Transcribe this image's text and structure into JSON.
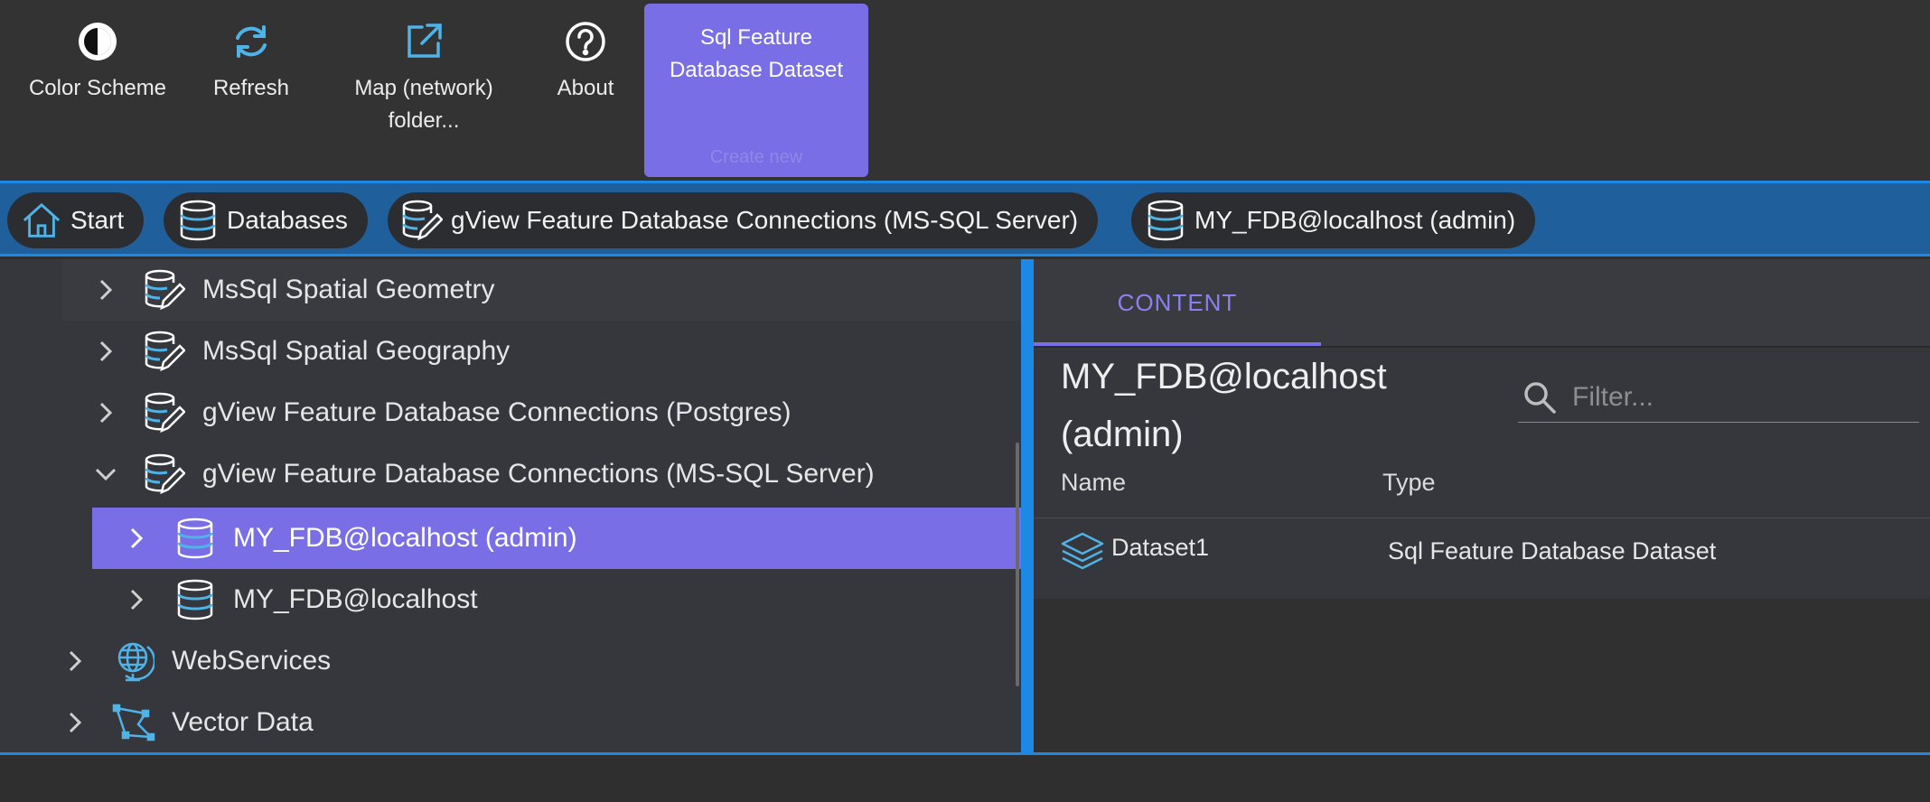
{
  "toolbar": {
    "color_scheme": "Color Scheme",
    "refresh": "Refresh",
    "map_folder": "Map (network) folder...",
    "about": "About",
    "create_title": "Sql Feature Database Dataset",
    "create_sub": "Create new"
  },
  "breadcrumbs": {
    "start": "Start",
    "databases": "Databases",
    "connections": "gView Feature Database Connections (MS-SQL Server)",
    "current": "MY_FDB@localhost (admin)"
  },
  "tree": {
    "items": [
      {
        "label": "MsSql Spatial Geometry"
      },
      {
        "label": "MsSql Spatial Geography"
      },
      {
        "label": "gView Feature Database Connections (Postgres)"
      },
      {
        "label": "gView Feature Database Connections (MS-SQL Server)"
      },
      {
        "label": "MY_FDB@localhost (admin)"
      },
      {
        "label": "MY_FDB@localhost"
      },
      {
        "label": "WebServices"
      },
      {
        "label": "Vector Data"
      }
    ]
  },
  "content": {
    "tab": "CONTENT",
    "title": "MY_FDB@localhost (admin)",
    "filter_placeholder": "Filter...",
    "columns": {
      "name": "Name",
      "type": "Type"
    },
    "rows": [
      {
        "name": "Dataset1",
        "type": "Sql Feature Database Dataset"
      }
    ]
  },
  "colors": {
    "accent": "#7a6ee6",
    "blue": "#1e88e5",
    "icon": "#4fb3e8"
  }
}
